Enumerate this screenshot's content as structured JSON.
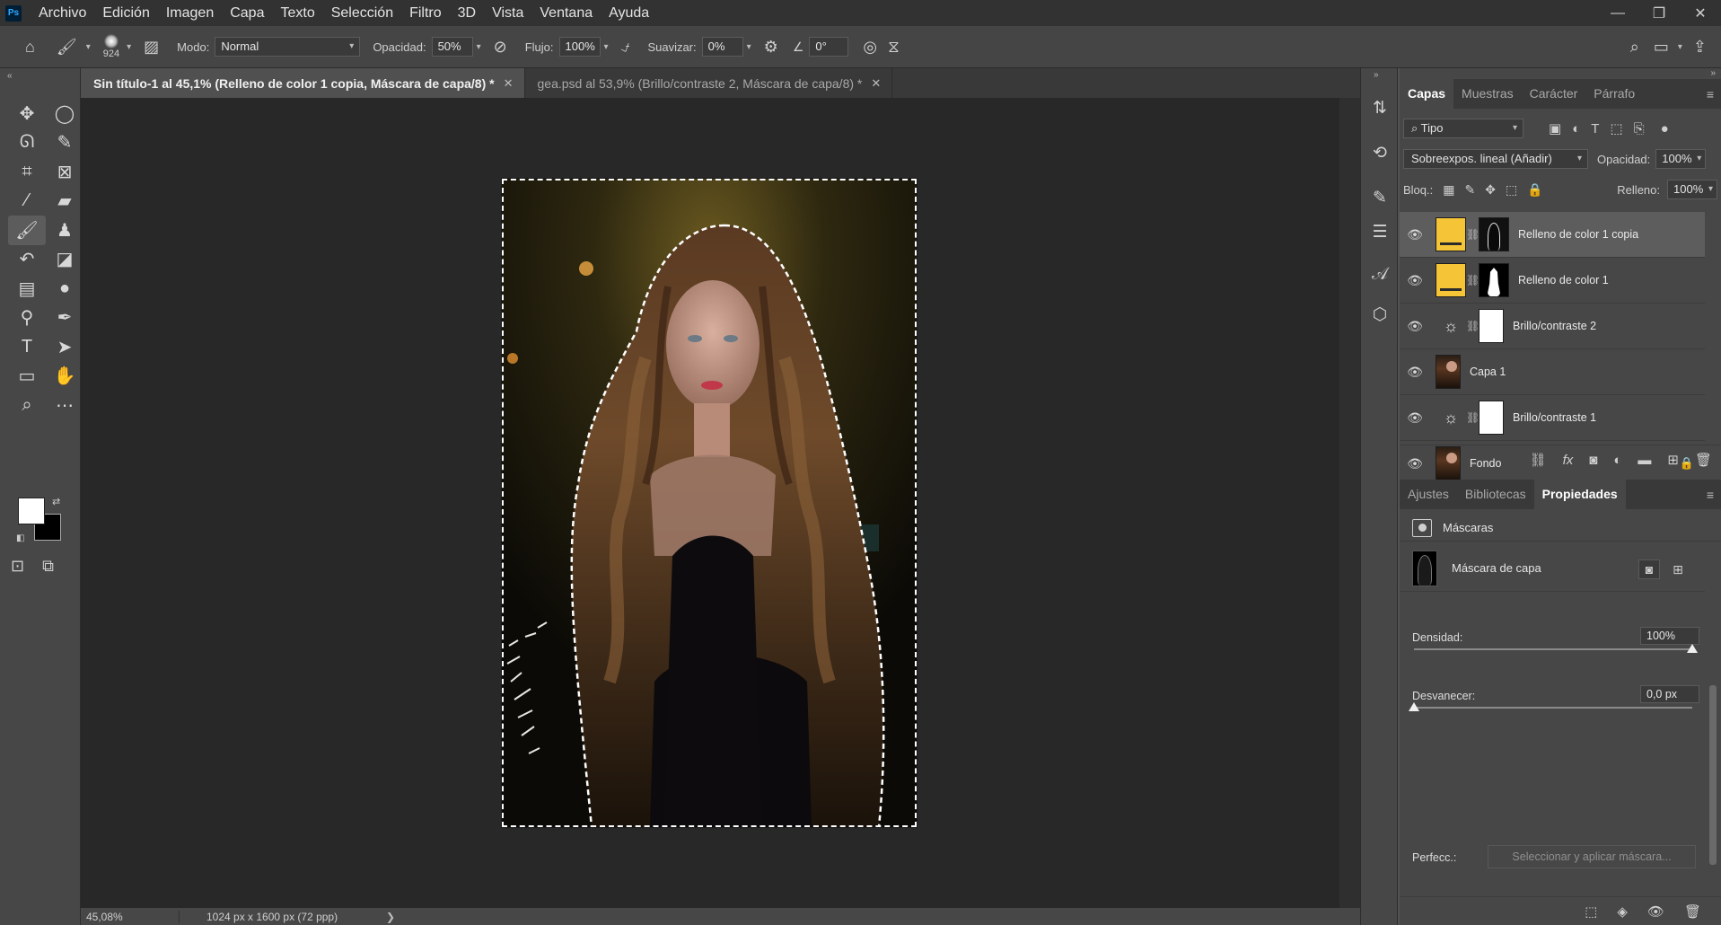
{
  "app": {
    "logo": "Ps",
    "menu": [
      "Archivo",
      "Edición",
      "Imagen",
      "Capa",
      "Texto",
      "Selección",
      "Filtro",
      "3D",
      "Vista",
      "Ventana",
      "Ayuda"
    ],
    "window_controls": [
      "—",
      "❐",
      "✕"
    ]
  },
  "options_bar": {
    "brush_size": "924",
    "mode_label": "Modo:",
    "mode_value": "Normal",
    "opacity_label": "Opacidad:",
    "opacity_value": "50%",
    "flow_label": "Flujo:",
    "flow_value": "100%",
    "smoothing_label": "Suavizar:",
    "smoothing_value": "0%",
    "angle_value": "0°"
  },
  "tabs": [
    {
      "label": "Sin título-1 al 45,1% (Relleno de color 1 copia, Máscara de capa/8) *",
      "active": true
    },
    {
      "label": "gea.psd al 53,9% (Brillo/contraste 2, Máscara de capa/8) *",
      "active": false
    }
  ],
  "status_bar": {
    "zoom": "45,08%",
    "doc_size": "1024 px x 1600 px (72 ppp)",
    "arrow": "❯"
  },
  "layers_panel": {
    "tabs": [
      "Capas",
      "Muestras",
      "Carácter",
      "Párrafo"
    ],
    "filter_type": "Tipo",
    "blend_mode": "Sobreexpos. lineal (Añadir)",
    "opacity_label": "Opacidad:",
    "opacity_value": "100%",
    "lock_label": "Bloq.:",
    "fill_label": "Relleno:",
    "fill_value": "100%",
    "layers": [
      {
        "name": "Relleno de color 1 copia",
        "kind": "fill",
        "fill_color": "#f6c537",
        "mask": "mask-a",
        "selected": true
      },
      {
        "name": "Relleno de color 1",
        "kind": "fill",
        "fill_color": "#f6c537",
        "mask": "mask-b",
        "selected": false
      },
      {
        "name": "Brillo/contraste 2",
        "kind": "adjustment",
        "mask": "white",
        "selected": false
      },
      {
        "name": "Capa 1",
        "kind": "pixel",
        "selected": false
      },
      {
        "name": "Brillo/contraste 1",
        "kind": "adjustment",
        "mask": "white",
        "selected": false
      },
      {
        "name": "Fondo",
        "kind": "background",
        "locked": true,
        "selected": false
      }
    ]
  },
  "properties_panel": {
    "tabs": [
      "Ajustes",
      "Bibliotecas",
      "Propiedades"
    ],
    "header": "Máscaras",
    "mask_label": "Máscara de capa",
    "density_label": "Densidad:",
    "density_value": "100%",
    "density_fraction": 1.0,
    "feather_label": "Desvanecer:",
    "feather_value": "0,0 px",
    "feather_fraction": 0.0,
    "refine_label": "Perfecc.:",
    "refine_button": "Seleccionar y aplicar máscara..."
  },
  "colors": {
    "foreground": "#ffffff",
    "background": "#000000",
    "fill_swatch": "#f6c537"
  }
}
